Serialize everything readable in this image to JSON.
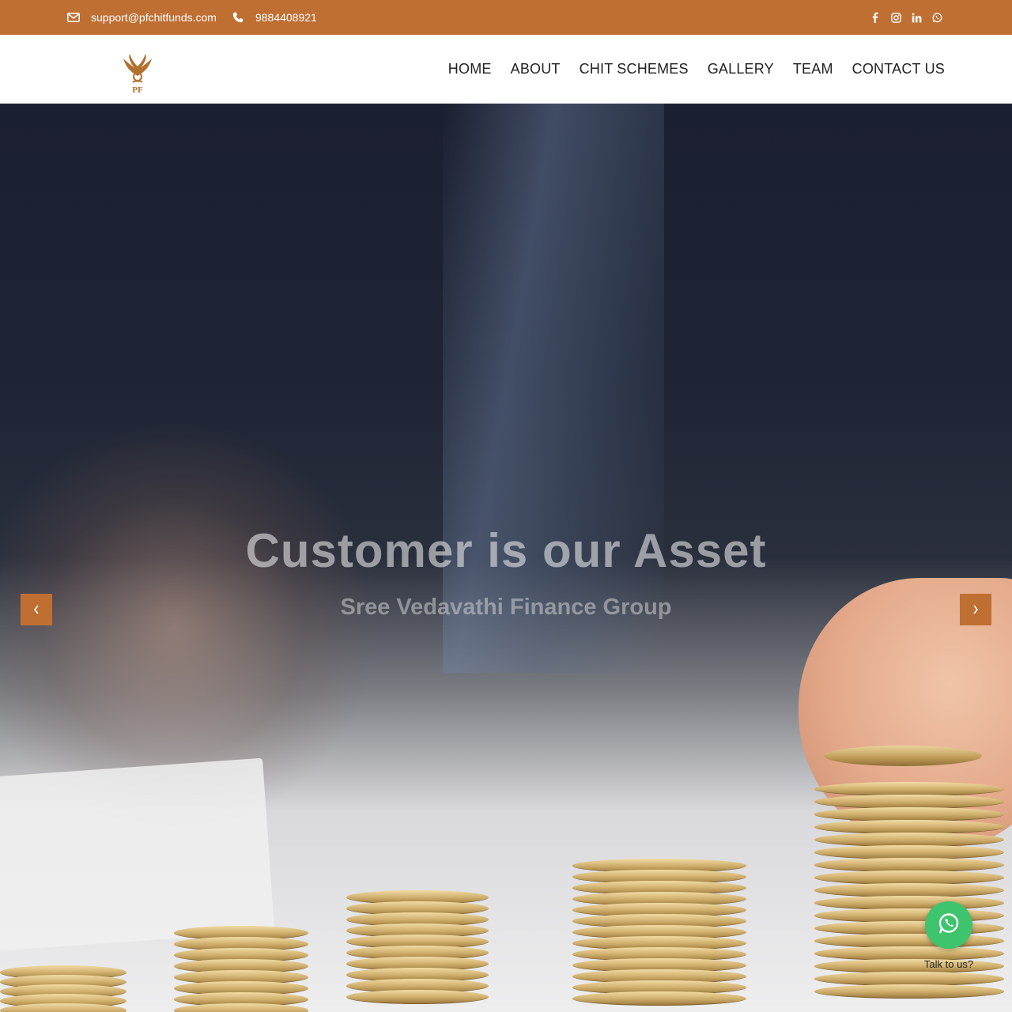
{
  "topbar": {
    "email": "support@pfchitfunds.com",
    "phone": "9884408921",
    "icons": [
      "envelope-icon",
      "phone-icon"
    ],
    "social": [
      "facebook-icon",
      "instagram-icon",
      "linkedin-icon",
      "whatsapp-icon"
    ],
    "bg_color": "#c06f33"
  },
  "header": {
    "logo_text": "PF",
    "nav": [
      "HOME",
      "ABOUT",
      "CHIT SCHEMES",
      "GALLERY",
      "TEAM",
      "CONTACT US"
    ]
  },
  "hero": {
    "title": "Customer is our Asset",
    "subtitle": "Sree Vedavathi Finance Group",
    "prev_icon": "chevron-left-icon",
    "next_icon": "chevron-right-icon"
  },
  "whatsapp_widget": {
    "label": "Talk to us?",
    "icon": "whatsapp-icon",
    "color": "#3ec46d"
  }
}
